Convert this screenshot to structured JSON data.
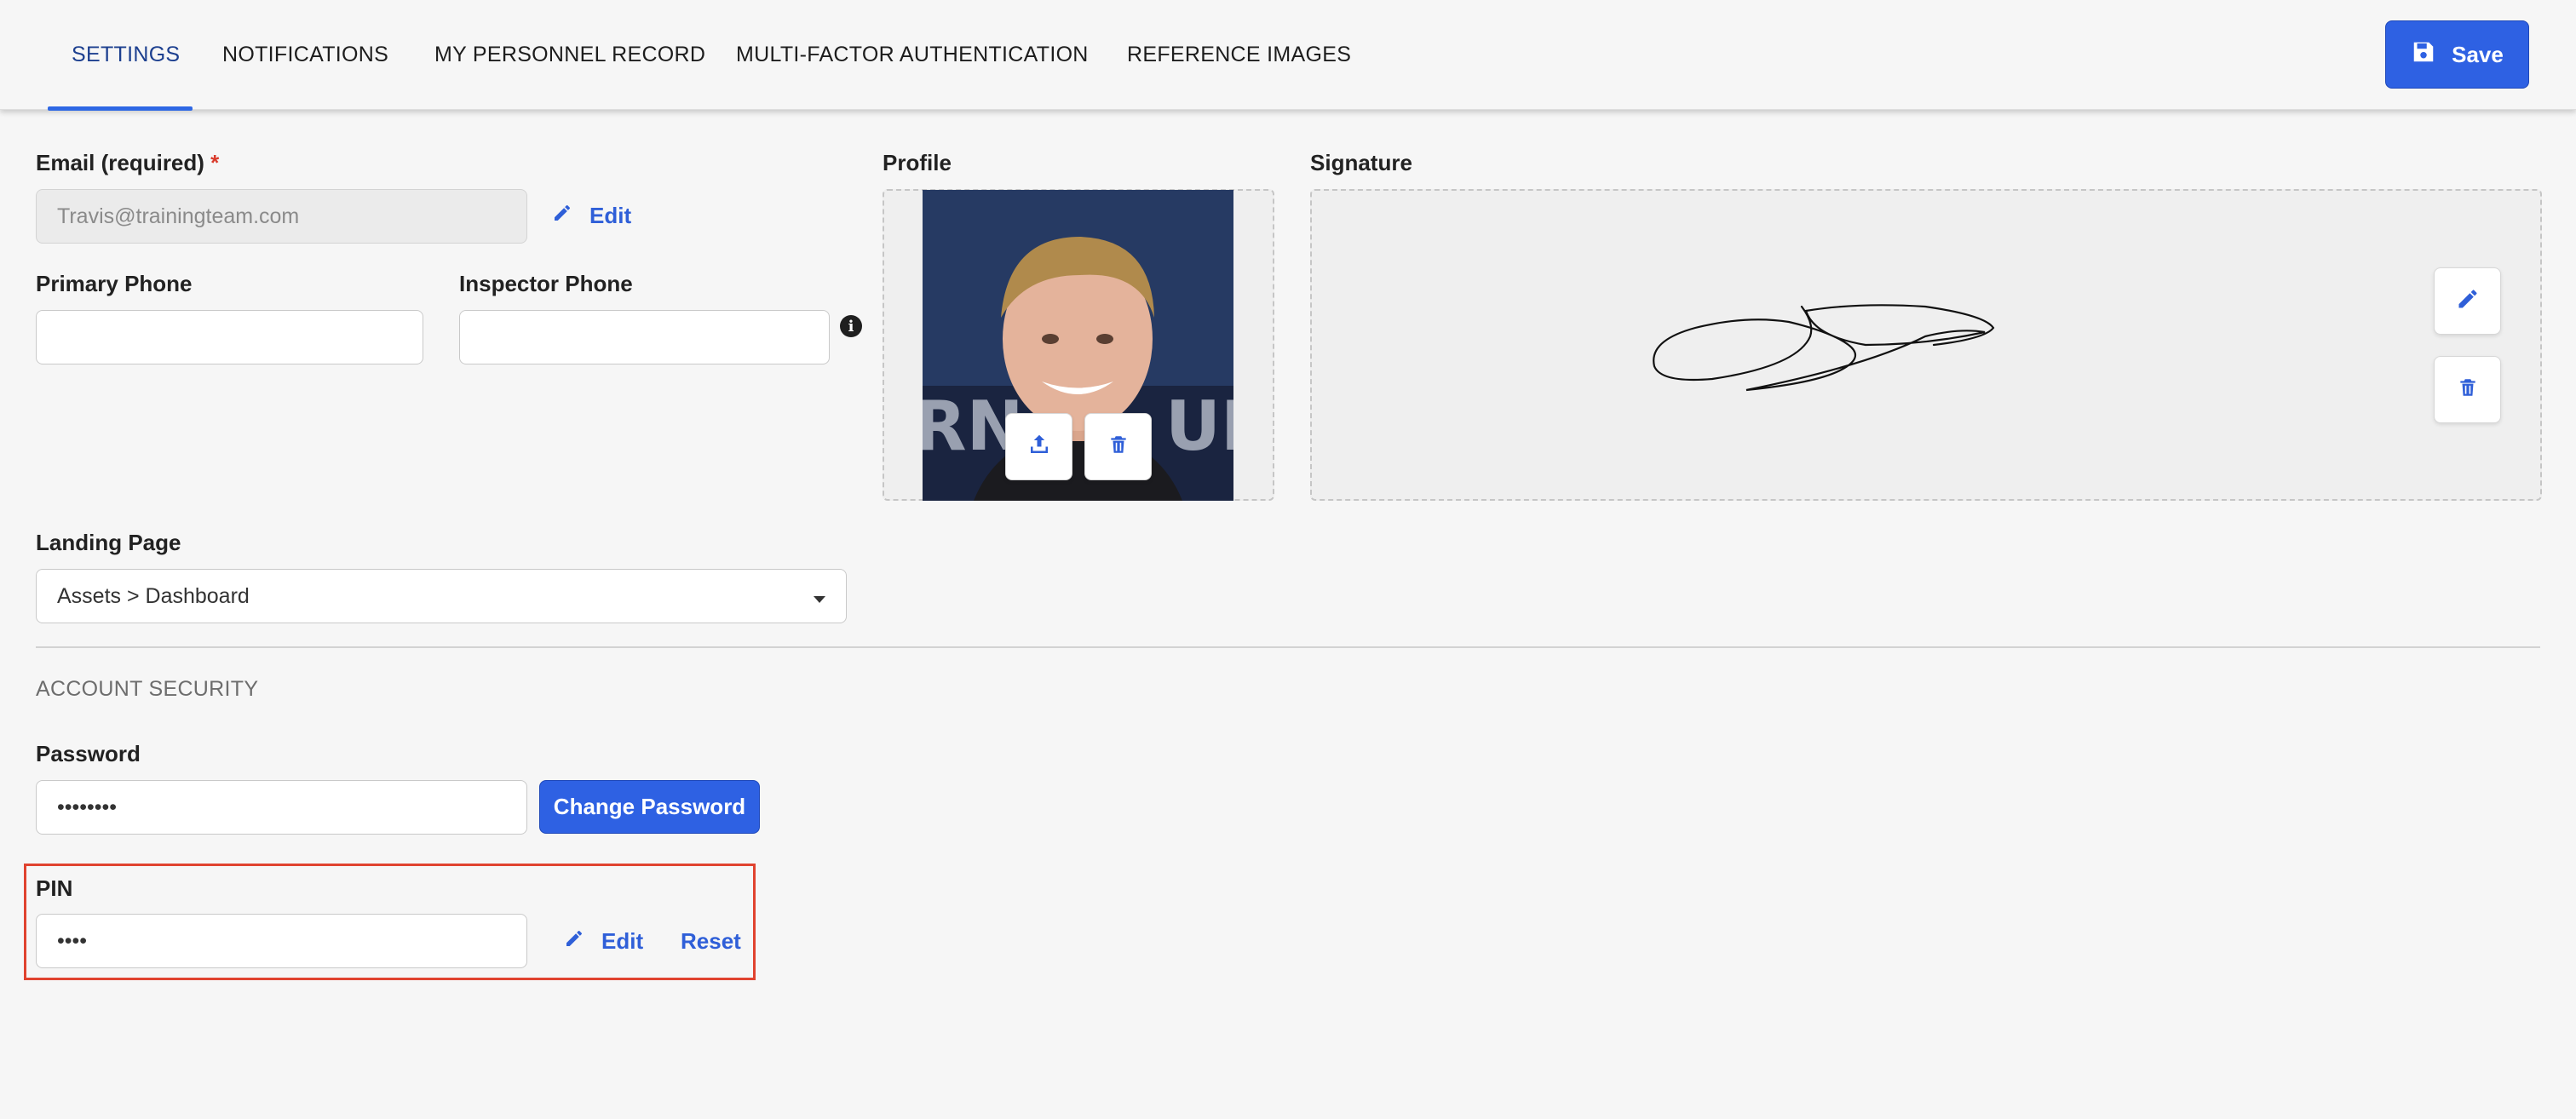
{
  "tabs": [
    {
      "label": "SETTINGS",
      "active": true
    },
    {
      "label": "NOTIFICATIONS",
      "active": false
    },
    {
      "label": "MY PERSONNEL RECORD",
      "active": false
    },
    {
      "label": "MULTI-FACTOR AUTHENTICATION",
      "active": false
    },
    {
      "label": "REFERENCE IMAGES",
      "active": false
    }
  ],
  "save_label": "Save",
  "email": {
    "label": "Email (required)",
    "required_mark": "*",
    "value": "Travis@trainingteam.com",
    "edit_label": "Edit"
  },
  "primary_phone": {
    "label": "Primary Phone",
    "value": ""
  },
  "inspector_phone": {
    "label": "Inspector Phone",
    "value": ""
  },
  "profile": {
    "label": "Profile"
  },
  "signature": {
    "label": "Signature"
  },
  "landing_page": {
    "label": "Landing Page",
    "value": "Assets > Dashboard"
  },
  "account_security": {
    "title": "ACCOUNT SECURITY",
    "password": {
      "label": "Password",
      "value": "••••••••",
      "change_label": "Change Password"
    },
    "pin": {
      "label": "PIN",
      "value": "••••",
      "edit_label": "Edit",
      "reset_label": "Reset"
    }
  },
  "colors": {
    "accent": "#2e61e3",
    "active_tab": "#1c3f8f",
    "highlight": "#e0432f"
  }
}
